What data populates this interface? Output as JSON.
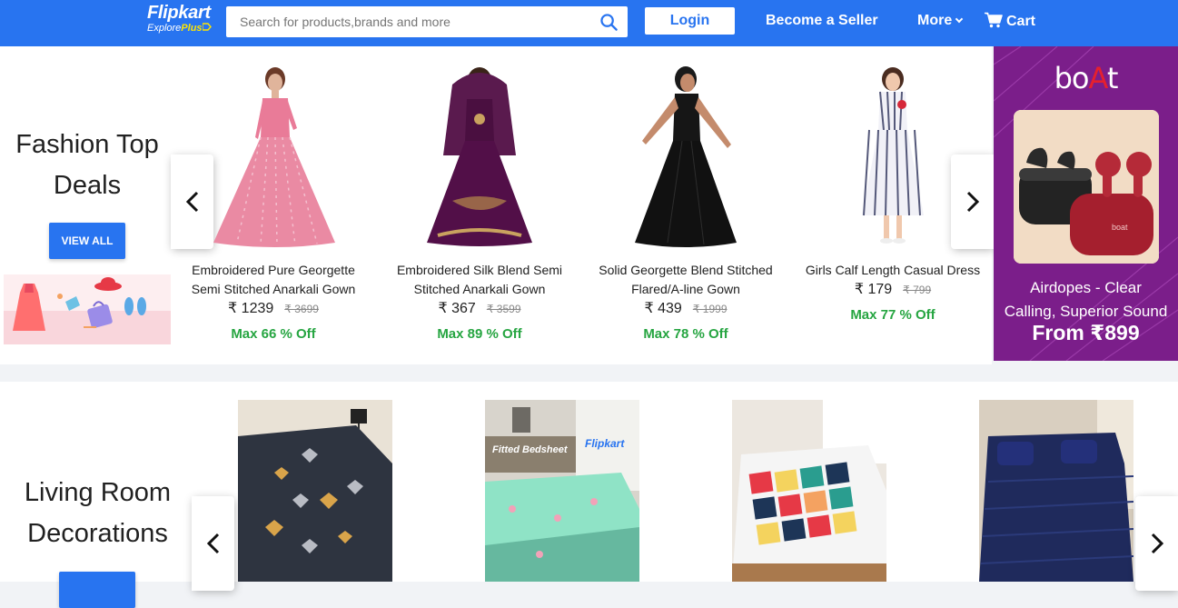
{
  "header": {
    "logo_brand": "Flipkart",
    "logo_sub": "Explore",
    "logo_sub_plus": "Plus",
    "search_placeholder": "Search for products,brands and more",
    "login_label": "Login",
    "seller_label": "Become a Seller",
    "more_label": "More",
    "cart_label": "Cart",
    "bg_color": "#2874f0",
    "icons": [
      "search-icon",
      "chevron-down-icon",
      "cart-icon"
    ]
  },
  "fashion": {
    "title_line1": "Fashion Top",
    "title_line2": "Deals",
    "view_all_label": "VIEW ALL",
    "products": [
      {
        "name_line1": "Embroidered Pure Georgette",
        "name_line2": "Semi Stitched Anarkali Gown",
        "price": "₹ 1239",
        "mrp": "₹ 3699",
        "offer": "Max 66 % Off"
      },
      {
        "name_line1": "Embroidered Silk Blend Semi",
        "name_line2": "Stitched Anarkali Gown",
        "price": "₹ 367",
        "mrp": "₹ 3599",
        "offer": "Max 89 % Off"
      },
      {
        "name_line1": "Solid Georgette Blend Stitched",
        "name_line2": "Flared/A-line Gown",
        "price": "₹ 439",
        "mrp": "₹ 1999",
        "offer": "Max 78 % Off"
      },
      {
        "name_line1": "Girls Calf Length Casual Dress",
        "name_line2": "",
        "price": "₹ 179",
        "mrp": "₹ 799",
        "offer": "Max 77 % Off"
      }
    ]
  },
  "ad": {
    "logo_a": "bo",
    "logo_b": "A",
    "logo_c": "t",
    "earbud_label": "boat",
    "headline_line1": "Airdopes - Clear",
    "headline_line2": "Calling, Superior Sound",
    "price_line": "From ₹899"
  },
  "living": {
    "title_line1": "Living Room",
    "title_line2": "Decorations",
    "banner_text": "Fitted Bedsheet",
    "banner_brand": "Flipkart"
  },
  "colors": {
    "accent": "#2874f0",
    "offer_green": "#26a541",
    "ad_purple": "#7b1e8a"
  }
}
